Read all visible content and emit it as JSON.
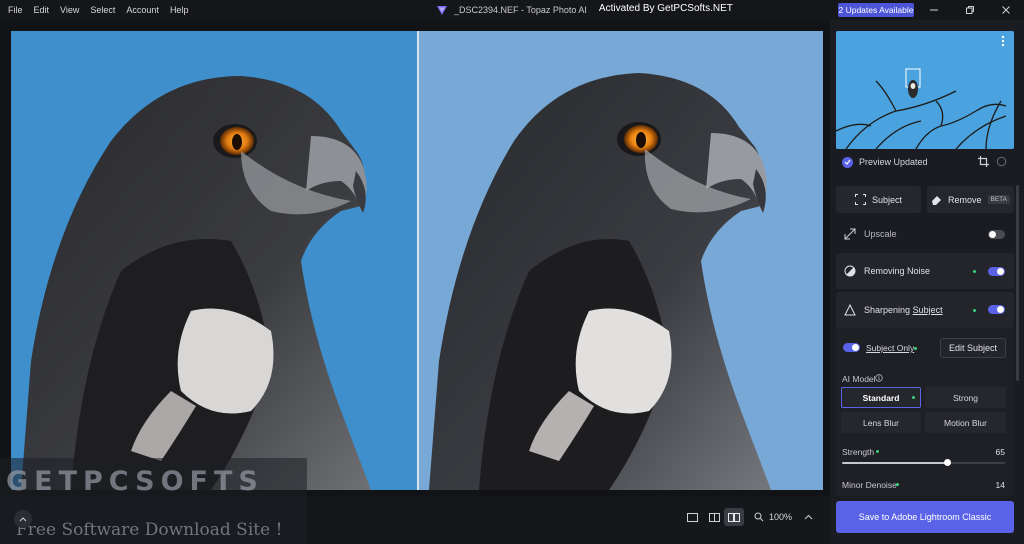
{
  "menu": {
    "items": [
      "File",
      "Edit",
      "View",
      "Select",
      "Account",
      "Help"
    ]
  },
  "window": {
    "title": "_DSC2394.NEF - Topaz Photo AI",
    "activation_text": "Activated By GetPCSofts.NET",
    "updates_label": "2 Updates Available"
  },
  "icons": {
    "minimize": "minimize-icon",
    "maximize": "restore-icon",
    "close": "close-icon",
    "more": "more-vertical-icon",
    "check": "check-circle-icon",
    "crop": "crop-icon",
    "sync": "sync-icon",
    "subject": "subject-frame-icon",
    "remove": "eraser-icon",
    "upscale": "expand-arrows-icon",
    "noise": "half-circle-icon",
    "sharpen": "triangle-icon",
    "info": "info-icon",
    "zoom": "zoom-icon"
  },
  "colors": {
    "accent": "#5a63e8",
    "status_green": "#38d07a",
    "panel_bg": "#1b1c21"
  },
  "preview": {
    "status": "Preview Updated"
  },
  "tools": {
    "subject_label": "Subject",
    "remove_label": "Remove",
    "remove_badge": "BETA"
  },
  "filters": {
    "upscale": {
      "label": "Upscale",
      "enabled": false
    },
    "noise": {
      "label": "Removing Noise",
      "enabled": true
    },
    "sharpen": {
      "label_prefix": "Sharpening",
      "label_link": "Subject",
      "enabled": true
    }
  },
  "sharpen_settings": {
    "subject_only_label": "Subject Only",
    "subject_only_enabled": true,
    "edit_subject_label": "Edit Subject",
    "ai_model_label": "AI Model",
    "models": [
      "Standard",
      "Strong",
      "Lens Blur",
      "Motion Blur"
    ],
    "selected_model": "Standard",
    "strength_label": "Strength",
    "strength_value": 65,
    "minor_denoise_label": "Minor Denoise",
    "minor_denoise_value": 14
  },
  "viewer": {
    "zoom_label": "100%"
  },
  "save": {
    "label": "Save to Adobe Lightroom Classic"
  },
  "watermark": {
    "brand": "GETPCSOFTS",
    "tagline": "Free Software Download Site !"
  }
}
